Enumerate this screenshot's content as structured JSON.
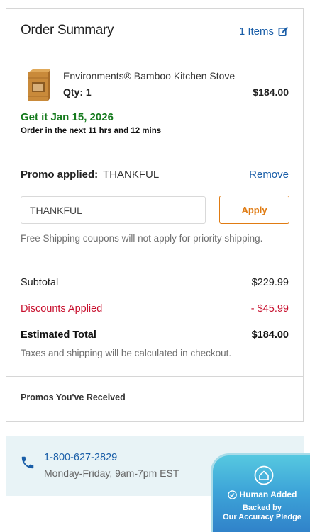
{
  "summary": {
    "title": "Order Summary",
    "items_link": "1 Items"
  },
  "product": {
    "name": "Environments® Bamboo Kitchen Stove",
    "qty": "Qty: 1",
    "price": "$184.00",
    "delivery": "Get it Jan 15, 2026",
    "order_in": "Order in the next 11 hrs and 12 mins"
  },
  "promo": {
    "label": "Promo applied:",
    "code": "THANKFUL",
    "remove": "Remove",
    "input_value": "THANKFUL",
    "apply": "Apply",
    "note": "Free Shipping coupons will not apply for priority shipping."
  },
  "totals": {
    "subtotal_label": "Subtotal",
    "subtotal_value": "$229.99",
    "discount_label": "Discounts Applied",
    "discount_value": "- $45.99",
    "estimated_label": "Estimated Total",
    "estimated_value": "$184.00",
    "tax_note": "Taxes and shipping will be calculated in checkout."
  },
  "promos_received": "Promos You've Received",
  "contact": {
    "phone": "1-800-627-2829",
    "hours": "Monday-Friday, 9am-7pm EST"
  },
  "badge": {
    "title": "Human Added",
    "subtitle_line1": "Backed by",
    "subtitle_line2": "Our Accuracy Pledge"
  },
  "colors": {
    "link": "#1a5ea8",
    "delivery_green": "#157a1d",
    "discount_red": "#c8102e",
    "apply_orange": "#e07b12",
    "contact_bg": "#e8f3f6"
  },
  "icons": {
    "edit": "edit-icon",
    "phone": "phone-icon",
    "badge": "house-icon",
    "check": "check-circle-icon"
  }
}
